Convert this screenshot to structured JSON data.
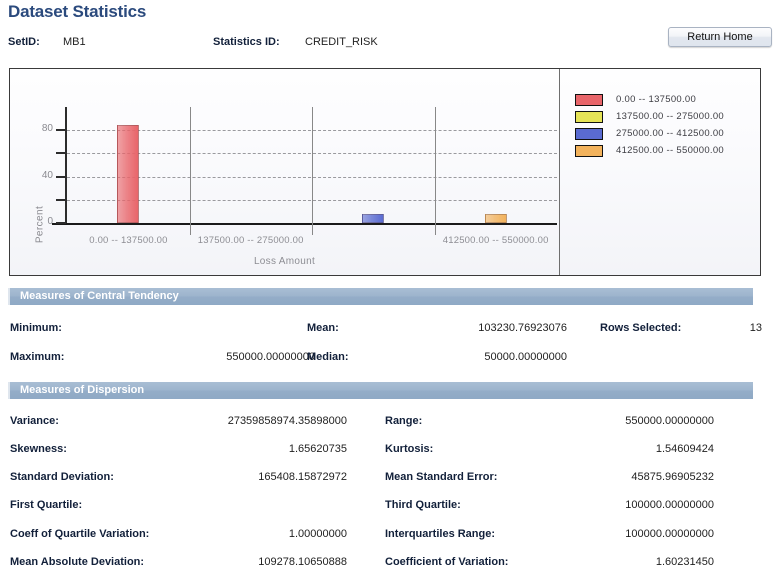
{
  "page": {
    "title": "Dataset Statistics",
    "setid_label": "SetID:",
    "setid_value": "MB1",
    "statistics_id_label": "Statistics ID:",
    "statistics_id_value": "CREDIT_RISK",
    "return_home_label": "Return Home"
  },
  "chart_data": {
    "type": "bar",
    "title": "",
    "xlabel": "Loss Amount",
    "ylabel": "Percent",
    "categories": [
      "0.00  --  137500.00",
      "137500.00  --  275000.00",
      "275000.00  --  412500.00",
      "412500.00  --  550000.00"
    ],
    "visible_tick_labels": [
      "0.00  --  137500.00",
      "137500.00  --  275000.00",
      "412500.00  --  550000.00"
    ],
    "values": [
      84.6,
      0,
      7.7,
      7.7
    ],
    "colors": [
      "#e8656a",
      "#e6e457",
      "#5a6bd1",
      "#f2b25c"
    ],
    "ylim": [
      0,
      100
    ],
    "ytick_labels": [
      "0",
      "40",
      "80"
    ],
    "ytick_values": [
      0,
      40,
      80
    ],
    "gridline_values": [
      20,
      40,
      60,
      80
    ],
    "grid": true,
    "legend_position": "right",
    "legend": [
      {
        "label": "0.00  --  137500.00",
        "color": "#e8656a"
      },
      {
        "label": "137500.00  --  275000.00",
        "color": "#e6e457"
      },
      {
        "label": "275000.00  --  412500.00",
        "color": "#5a6bd1"
      },
      {
        "label": "412500.00  --  550000.00",
        "color": "#f2b25c"
      }
    ]
  },
  "central_tendency": {
    "header": "Measures of Central Tendency",
    "minimum_label": "Minimum:",
    "minimum_value": "",
    "maximum_label": "Maximum:",
    "maximum_value": "550000.00000000",
    "mean_label": "Mean:",
    "mean_value": "103230.76923076",
    "median_label": "Median:",
    "median_value": "50000.00000000",
    "rows_selected_label": "Rows Selected:",
    "rows_selected_value": "13"
  },
  "dispersion": {
    "header": "Measures of Dispersion",
    "variance_label": "Variance:",
    "variance_value": "27359858974.35898000",
    "range_label": "Range:",
    "range_value": "550000.00000000",
    "skewness_label": "Skewness:",
    "skewness_value": "1.65620735",
    "kurtosis_label": "Kurtosis:",
    "kurtosis_value": "1.54609424",
    "std_dev_label": "Standard Deviation:",
    "std_dev_value": "165408.15872972",
    "mean_std_error_label": "Mean Standard Error:",
    "mean_std_error_value": "45875.96905232",
    "first_quartile_label": "First Quartile:",
    "first_quartile_value": "",
    "third_quartile_label": "Third Quartile:",
    "third_quartile_value": "100000.00000000",
    "coeff_quartile_var_label": "Coeff of Quartile Variation:",
    "coeff_quartile_var_value": "1.00000000",
    "interquartiles_range_label": "Interquartiles Range:",
    "interquartiles_range_value": "100000.00000000",
    "mean_abs_dev_label": "Mean Absolute Deviation:",
    "mean_abs_dev_value": "109278.10650888",
    "coeff_variation_label": "Coefficient of Variation:",
    "coeff_variation_value": "1.60231450"
  }
}
